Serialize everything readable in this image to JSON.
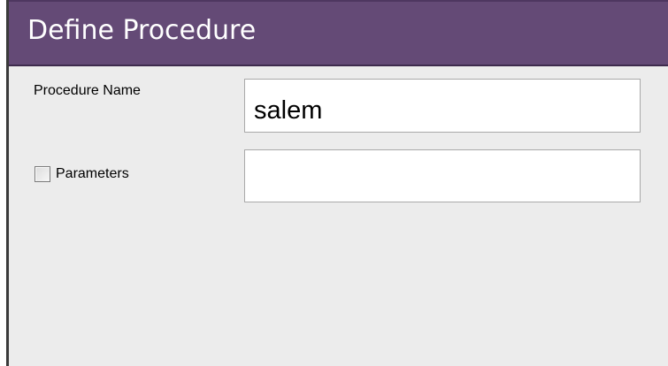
{
  "dialog": {
    "title": "Define Procedure"
  },
  "form": {
    "procedure_name": {
      "label": "Procedure Name",
      "value": "salem"
    },
    "parameters": {
      "label": "Parameters",
      "checked": false,
      "value": ""
    }
  },
  "colors": {
    "title_bar": "#644a76",
    "window_background": "#ececec"
  }
}
